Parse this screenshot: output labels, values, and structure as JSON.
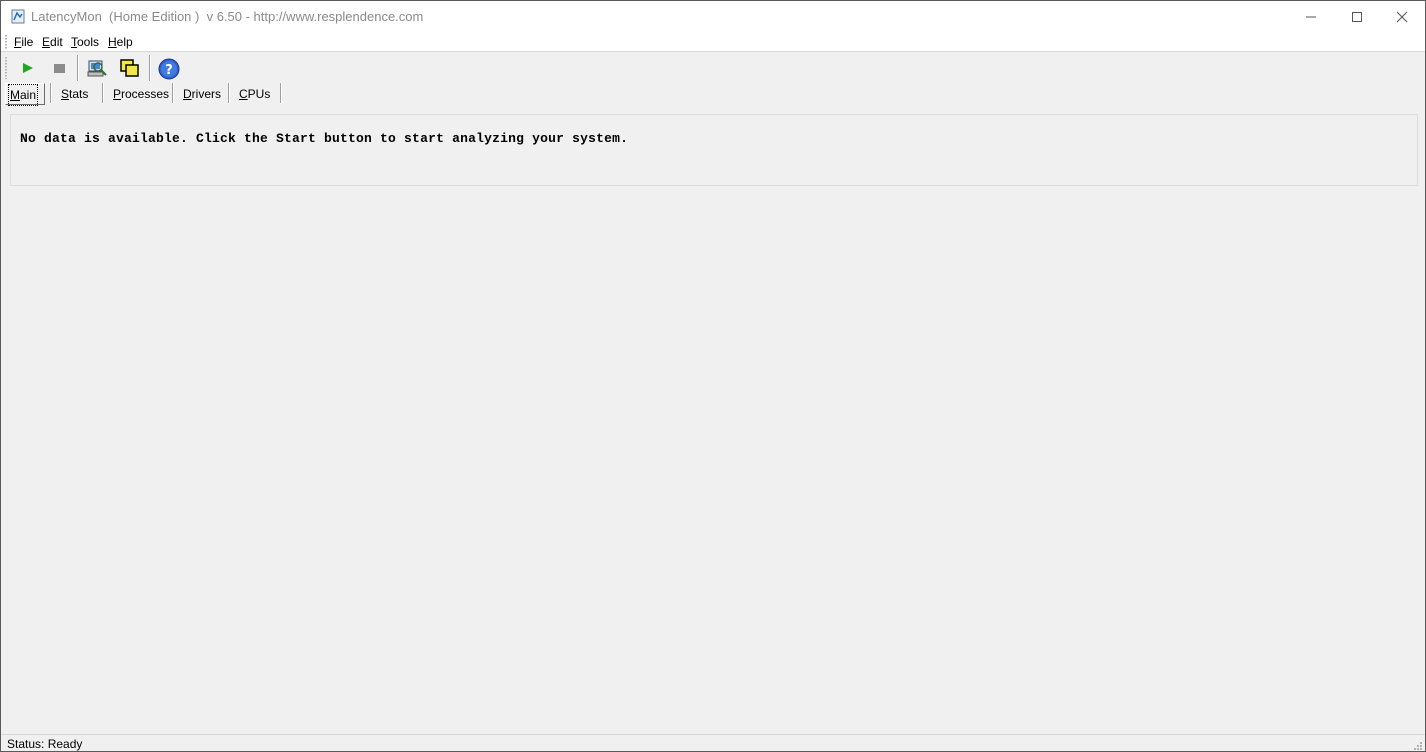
{
  "window": {
    "title": "LatencyMon  (Home Edition )  v 6.50 - http://www.resplendence.com",
    "icon": "latencymon-app-icon"
  },
  "menu": {
    "items": [
      {
        "label": "File",
        "mnemonic": "F"
      },
      {
        "label": "Edit",
        "mnemonic": "E"
      },
      {
        "label": "Tools",
        "mnemonic": "T"
      },
      {
        "label": "Help",
        "mnemonic": "H"
      }
    ]
  },
  "toolbar": {
    "buttons": [
      {
        "icon": "play-icon",
        "color": "#1fa81f"
      },
      {
        "icon": "stop-icon",
        "color": "#8c8c8c"
      },
      {
        "icon": "computer-search-icon"
      },
      {
        "icon": "windows-icon"
      },
      {
        "icon": "help-icon",
        "color": "#2f5fcf"
      }
    ]
  },
  "tabs": [
    {
      "label": "Main",
      "active": true
    },
    {
      "label": "Stats",
      "active": false
    },
    {
      "label": "Processes",
      "active": false
    },
    {
      "label": "Drivers",
      "active": false
    },
    {
      "label": "CPUs",
      "active": false
    }
  ],
  "main": {
    "message": "No data is available. Click the Start button to start analyzing your system."
  },
  "status": {
    "text": "Status: Ready"
  }
}
